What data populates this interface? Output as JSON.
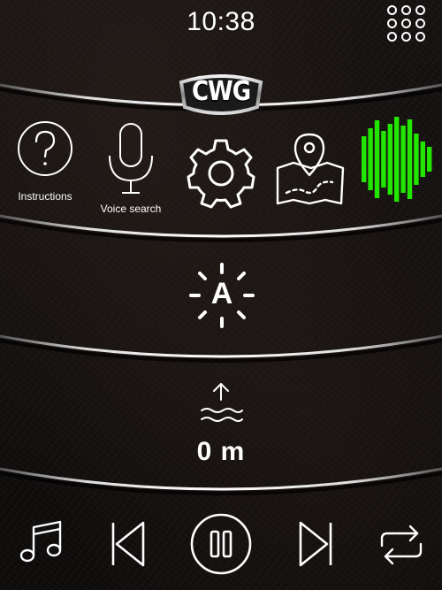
{
  "status_bar": {
    "time": "10:38",
    "apps_icon": "grid-dots-icon"
  },
  "brand": {
    "logo_text": "CWG"
  },
  "quick_actions": [
    {
      "id": "instructions",
      "icon": "question-circle-icon",
      "label": "Instructions"
    },
    {
      "id": "voice_search",
      "icon": "microphone-icon",
      "label": "Voice search"
    },
    {
      "id": "settings",
      "icon": "gear-icon",
      "label": ""
    },
    {
      "id": "map",
      "icon": "map-pin-icon",
      "label": ""
    },
    {
      "id": "audio",
      "icon": "sound-wave-icon",
      "label": ""
    }
  ],
  "brightness": {
    "mode_letter": "A",
    "icon": "auto-brightness-icon"
  },
  "depth": {
    "icon": "water-level-up-icon",
    "value": "0 m"
  },
  "media_controls": [
    {
      "id": "music",
      "icon": "music-note-icon"
    },
    {
      "id": "previous",
      "icon": "skip-previous-icon"
    },
    {
      "id": "pause",
      "icon": "pause-circle-icon"
    },
    {
      "id": "next",
      "icon": "skip-next-icon"
    },
    {
      "id": "repeat",
      "icon": "repeat-icon"
    }
  ],
  "colors": {
    "accent_green": "#22e600",
    "foreground": "#ffffff",
    "background": "#121010"
  }
}
